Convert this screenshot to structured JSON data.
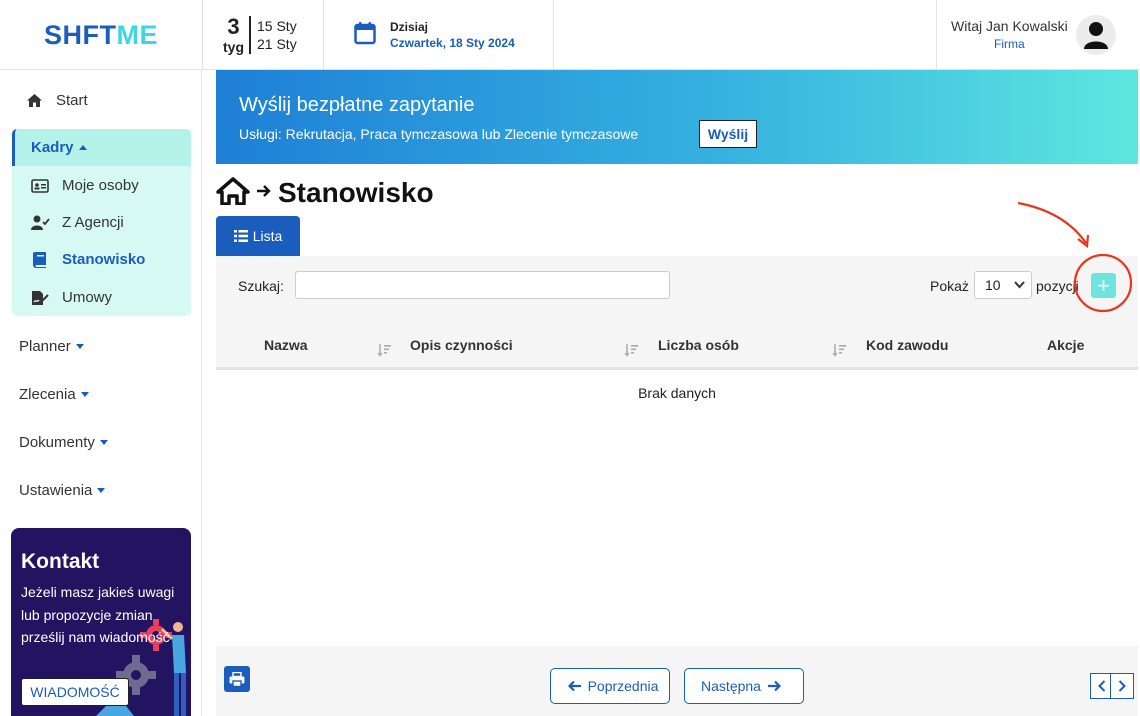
{
  "header": {
    "logo_part1": "SHFT",
    "logo_part2": "ME",
    "week_number": "3",
    "week_label": "tyg",
    "week_start": "15 Sty",
    "week_end": "21 Sty",
    "today_label": "Dzisiaj",
    "today_date": "Czwartek, 18 Sty 2024",
    "greeting": "Witaj Jan Kowalski",
    "company": "Firma"
  },
  "sidebar": {
    "start": "Start",
    "kadry": "Kadry",
    "kadry_items": [
      "Moje osoby",
      "Z Agencji",
      "Stanowisko",
      "Umowy"
    ],
    "planner": "Planner",
    "zlecenia": "Zlecenia",
    "dokumenty": "Dokumenty",
    "ustawienia": "Ustawienia",
    "kontakt_title": "Kontakt",
    "kontakt_text": "Jeżeli masz jakieś uwagi lub propozycje zmian prześlij nam wiadomość",
    "kontakt_button": "WIADOMOŚĆ"
  },
  "banner": {
    "title": "Wyślij bezpłatne zapytanie",
    "subtitle": "Usługi: Rekrutacja, Praca tymczasowa lub Zlecenie tymczasowe",
    "button": "Wyślij"
  },
  "page": {
    "title": "Stanowisko",
    "tab_list": "Lista"
  },
  "table": {
    "search_label": "Szukaj:",
    "show_label": "Pokaż",
    "page_size": "10",
    "entries_label": "pozycji",
    "add_symbol": "+",
    "columns": [
      "Nazwa",
      "Opis czynności",
      "Liczba osób",
      "Kod zawodu",
      "Akcje"
    ],
    "empty": "Brak danych"
  },
  "pagination": {
    "prev": "Poprzednia",
    "next": "Następna"
  },
  "colors": {
    "brand_blue": "#1a5dbd",
    "accent_teal": "#3fd6e3",
    "annotation_red": "#e8361c"
  }
}
